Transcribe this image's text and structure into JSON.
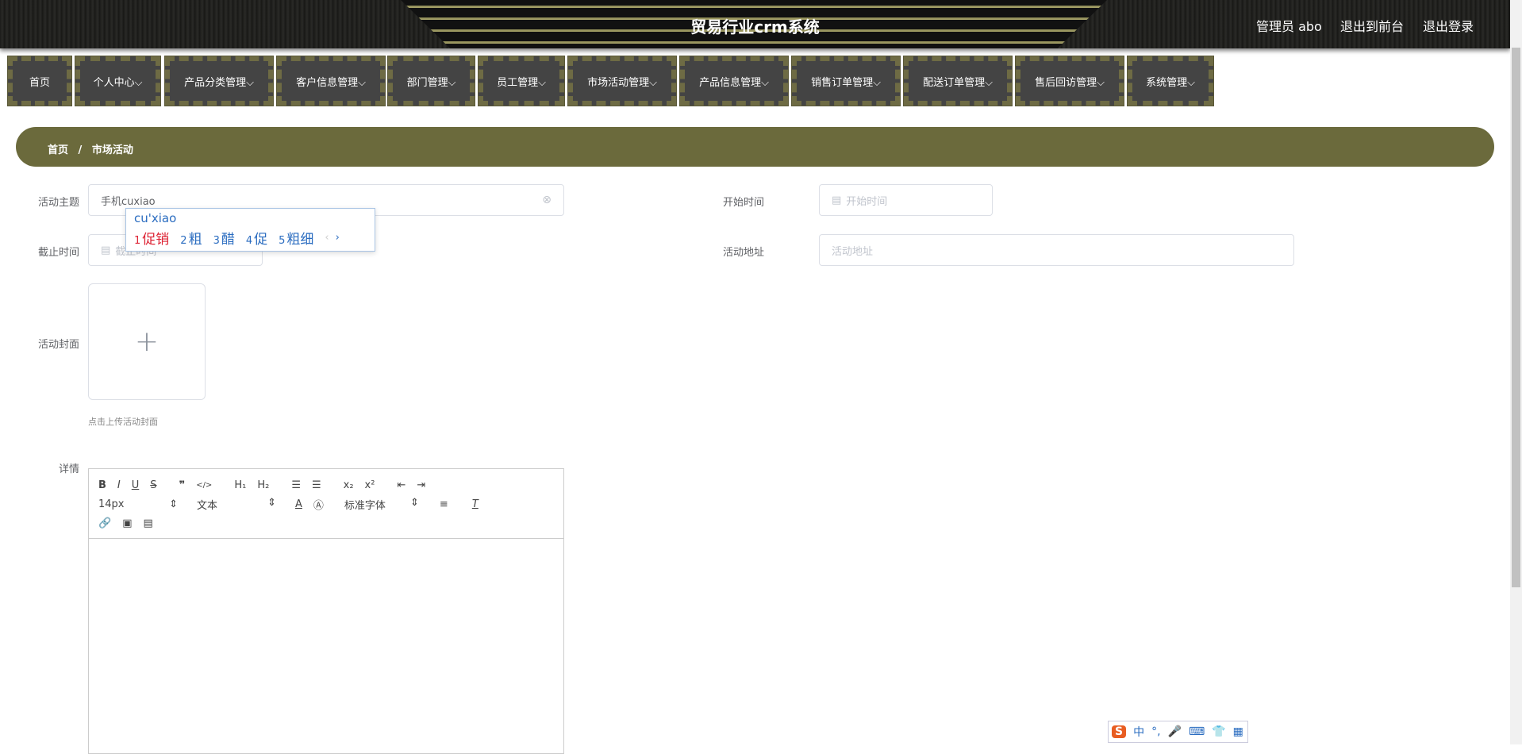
{
  "header": {
    "title": "贸易行业crm系统",
    "user": "管理员 abo",
    "front": "退出到前台",
    "logout": "退出登录"
  },
  "nav": [
    "首页",
    "个人中心⌵",
    "产品分类管理⌵",
    "客户信息管理⌵",
    "部门管理⌵",
    "员工管理⌵",
    "市场活动管理⌵",
    "产品信息管理⌵",
    "销售订单管理⌵",
    "配送订单管理⌵",
    "售后回访管理⌵",
    "系统管理⌵"
  ],
  "breadcrumb": {
    "home": "首页",
    "sep": "/",
    "current": "市场活动"
  },
  "form": {
    "subject_label": "活动主题",
    "subject_value": "手机cuxiao",
    "start_label": "开始时间",
    "start_placeholder": "开始时间",
    "end_label": "截止时间",
    "end_placeholder": "截止时间",
    "address_label": "活动地址",
    "address_placeholder": "活动地址",
    "cover_label": "活动封面",
    "cover_hint": "点击上传活动封面",
    "detail_label": "详情"
  },
  "ime": {
    "pinyin": "cu'xiao",
    "candidates": [
      {
        "n": "1",
        "w": "促销"
      },
      {
        "n": "2",
        "w": "粗"
      },
      {
        "n": "3",
        "w": "醋"
      },
      {
        "n": "4",
        "w": "促"
      },
      {
        "n": "5",
        "w": "粗细"
      }
    ]
  },
  "editor": {
    "size": "14px",
    "header": "文本",
    "font": "标准字体"
  },
  "sogou": {
    "mode": "中",
    "punct": "°,"
  }
}
